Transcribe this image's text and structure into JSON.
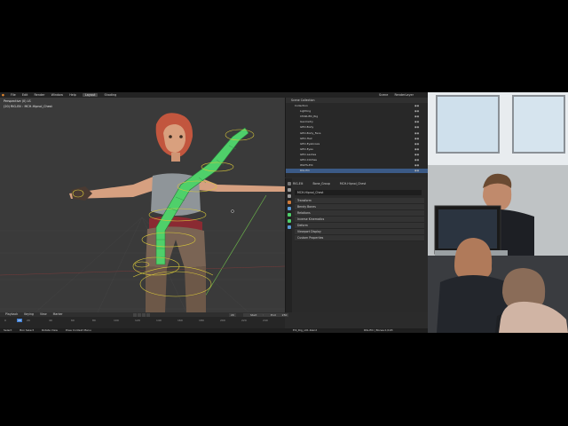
{
  "topbar": {
    "menus": [
      "File",
      "Edit",
      "Render",
      "Window",
      "Help"
    ],
    "workspaces": [
      "Layout",
      "Shading"
    ],
    "scene": "Scene",
    "view_layer": "RenderLayer"
  },
  "viewport": {
    "view_label": "Perspective (0) LS",
    "object_label": "(20) RIG-Elli : MCH-Hipnol_Chest"
  },
  "timeline": {
    "menus": [
      "Playback",
      "Keying",
      "View",
      "Marker"
    ],
    "start_label": "Start",
    "start_value": "1",
    "end_label": "End",
    "end_value": "250",
    "current_frame": "20",
    "ticks": [
      "0",
      "20",
      "40",
      "60",
      "80",
      "100",
      "120",
      "140",
      "160",
      "180",
      "200",
      "220",
      "240"
    ]
  },
  "outliner": {
    "header": "Scene Collection",
    "rows": [
      {
        "label": "Collection",
        "indent": 1,
        "selected": false
      },
      {
        "label": "Lighting",
        "indent": 2,
        "selected": false
      },
      {
        "label": "CHAR-Elli_Rig",
        "indent": 2,
        "selected": false
      },
      {
        "label": "Geometry",
        "indent": 2,
        "selected": false
      },
      {
        "label": "GEO-Body",
        "indent": 2,
        "selected": false
      },
      {
        "label": "GEO-Body_Face",
        "indent": 2,
        "selected": false
      },
      {
        "label": "GEO-Hair",
        "indent": 2,
        "selected": false
      },
      {
        "label": "GEO-Eyebrows",
        "indent": 2,
        "selected": false
      },
      {
        "label": "GEO-Eyes",
        "indent": 2,
        "selected": false
      },
      {
        "label": "GEO-Lashes",
        "indent": 2,
        "selected": false
      },
      {
        "label": "GEO-Clothes",
        "indent": 2,
        "selected": false
      },
      {
        "label": "WGTS-Elli",
        "indent": 2,
        "selected": false
      },
      {
        "label": "RIG-Elli",
        "indent": 2,
        "selected": true
      }
    ]
  },
  "properties": {
    "breadcrumb": [
      "RIG-Elli",
      "Bone_Group",
      "MCH-Hipnol_Chest"
    ],
    "bone_name": "MCH-Hipnol_Chest",
    "panels": [
      "Transform",
      "Bendy Bones",
      "Relations",
      "Inverse Kinematics",
      "Deform",
      "Viewport Display",
      "Custom Properties"
    ]
  },
  "statusbar": {
    "items": [
      "Select",
      "Box Select",
      "Rotate View",
      "Pose Context Menu"
    ],
    "file": "Elli_Rig_v01.blend",
    "info": "RIG-Elli | Bones:1/193"
  },
  "colors": {
    "accent": "#3f7fd6",
    "bone_green": "#4fd06a",
    "bone_yellow": "#d8c83a"
  }
}
